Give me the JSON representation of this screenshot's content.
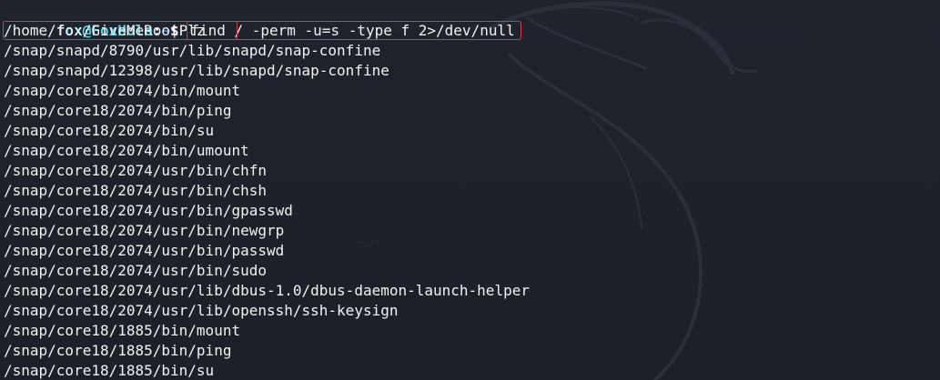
{
  "prompt": {
    "user_host": "fox@FoxHole",
    "separator": ":",
    "path": "~",
    "symbol": "$ "
  },
  "command": "find / -perm -u=s -type f 2>/dev/null",
  "output": [
    "/home/fox/GiveMeRootPlz",
    "/snap/snapd/8790/usr/lib/snapd/snap-confine",
    "/snap/snapd/12398/usr/lib/snapd/snap-confine",
    "/snap/core18/2074/bin/mount",
    "/snap/core18/2074/bin/ping",
    "/snap/core18/2074/bin/su",
    "/snap/core18/2074/bin/umount",
    "/snap/core18/2074/usr/bin/chfn",
    "/snap/core18/2074/usr/bin/chsh",
    "/snap/core18/2074/usr/bin/gpasswd",
    "/snap/core18/2074/usr/bin/newgrp",
    "/snap/core18/2074/usr/bin/passwd",
    "/snap/core18/2074/usr/bin/sudo",
    "/snap/core18/2074/usr/lib/dbus-1.0/dbus-daemon-launch-helper",
    "/snap/core18/2074/usr/lib/openssh/ssh-keysign",
    "/snap/core18/1885/bin/mount",
    "/snap/core18/1885/bin/ping",
    "/snap/core18/1885/bin/su"
  ],
  "theme": {
    "background": "#1e222b",
    "highlight": "#d9393e",
    "user_color": "#5bd7ea",
    "path_color": "#4a8cf0"
  }
}
